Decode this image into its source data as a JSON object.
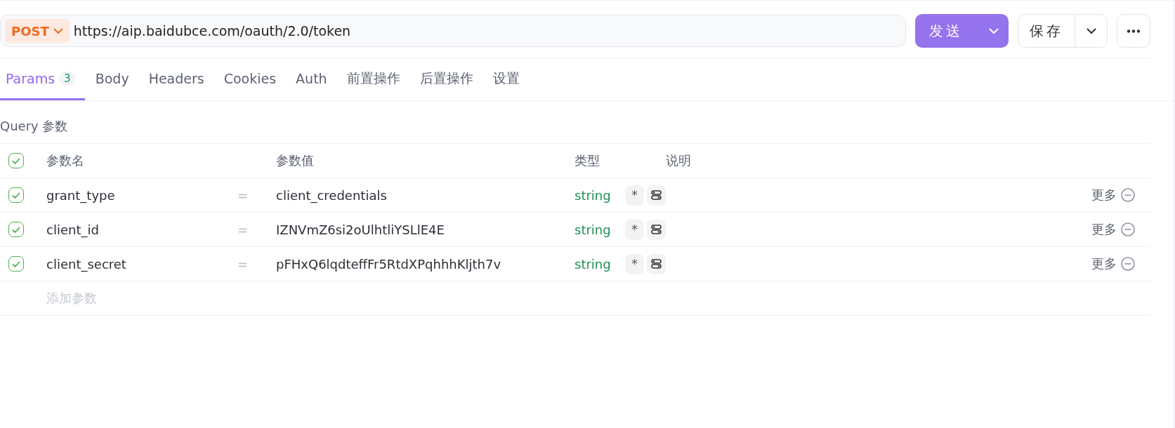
{
  "request": {
    "method": "POST",
    "url": "https://aip.baidubce.com/oauth/2.0/token",
    "send_label": "发送",
    "save_label": "保存"
  },
  "tabs": [
    {
      "label": "Params",
      "badge": "3",
      "selected": true
    },
    {
      "label": "Body",
      "selected": false
    },
    {
      "label": "Headers",
      "selected": false
    },
    {
      "label": "Cookies",
      "selected": false
    },
    {
      "label": "Auth",
      "selected": false
    },
    {
      "label": "前置操作",
      "selected": false
    },
    {
      "label": "后置操作",
      "selected": false
    },
    {
      "label": "设置",
      "selected": false
    }
  ],
  "section_title": "Query 参数",
  "table": {
    "all_checked": true,
    "columns": [
      "参数名",
      "参数值",
      "类型",
      "说明"
    ],
    "rows": [
      {
        "checked": true,
        "name": "grant_type",
        "equals": "=",
        "value": "client_credentials",
        "type": "string",
        "required_mark": "*",
        "more": "更多"
      },
      {
        "checked": true,
        "name": "client_id",
        "equals": "=",
        "value": "IZNVmZ6si2oUlhtliYSLlE4E",
        "type": "string",
        "required_mark": "*",
        "more": "更多"
      },
      {
        "checked": true,
        "name": "client_secret",
        "equals": "=",
        "value": "pFHxQ6lqdteffFr5RtdXPqhhhKljth7v",
        "type": "string",
        "required_mark": "*",
        "more": "更多"
      }
    ],
    "add_placeholder": "添加参数"
  }
}
